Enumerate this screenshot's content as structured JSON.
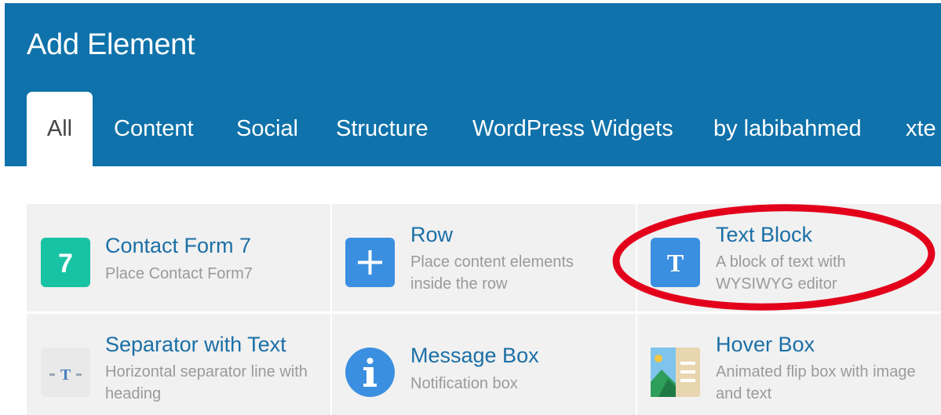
{
  "dialog": {
    "title": "Add Element"
  },
  "tabs": [
    {
      "label": "All",
      "active": true
    },
    {
      "label": "Content"
    },
    {
      "label": "Social"
    },
    {
      "label": "Structure"
    },
    {
      "label": "WordPress Widgets"
    },
    {
      "label": "by labibahmed"
    },
    {
      "label": "xte"
    }
  ],
  "elements": [
    {
      "title": "Contact Form 7",
      "description": "Place Contact Form7",
      "icon": "contact-form-7-icon",
      "icon_glyph": "7",
      "icon_color": "#18c3a3"
    },
    {
      "title": "Row",
      "description": "Place content elements inside the row",
      "icon": "plus-icon",
      "icon_color": "#3b8fe0"
    },
    {
      "title": "Text Block",
      "description": "A block of text with WYSIWYG editor",
      "icon": "text-block-icon",
      "icon_glyph": "T",
      "icon_color": "#3b8fe0"
    },
    {
      "title": "Separator with Text",
      "description": "Horizontal separator line with heading",
      "icon": "separator-text-icon",
      "icon_glyph": "-T-",
      "icon_color": "#e9e9e9"
    },
    {
      "title": "Message Box",
      "description": "Notification box",
      "icon": "info-icon",
      "icon_glyph": "i",
      "icon_color": "#3b8fe0"
    },
    {
      "title": "Hover Box",
      "description": "Animated flip box with image and text",
      "icon": "image-text-icon",
      "icon_color": "#e8d6b0"
    }
  ],
  "colors": {
    "header": "#0f72aa",
    "card_background": "#f1f1f1",
    "title_link": "#1b6fa6",
    "annotation_ring": "#e3001b"
  }
}
